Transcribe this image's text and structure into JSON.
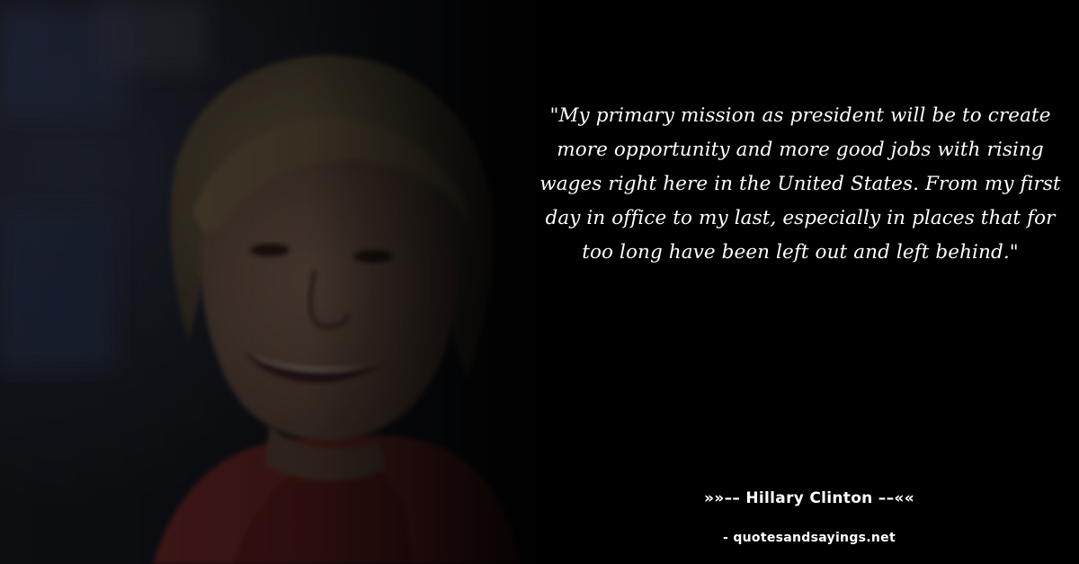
{
  "quote": {
    "text": "\"My primary mission as president will be to create more opportunity and more good jobs with rising wages right here in the United States. From my first day in office to my last, especially in places that for too long have been left out and left behind.\""
  },
  "author": {
    "line": "»»–– Hillary Clinton ––««"
  },
  "source": {
    "line": "- quotesandsayings.net"
  }
}
